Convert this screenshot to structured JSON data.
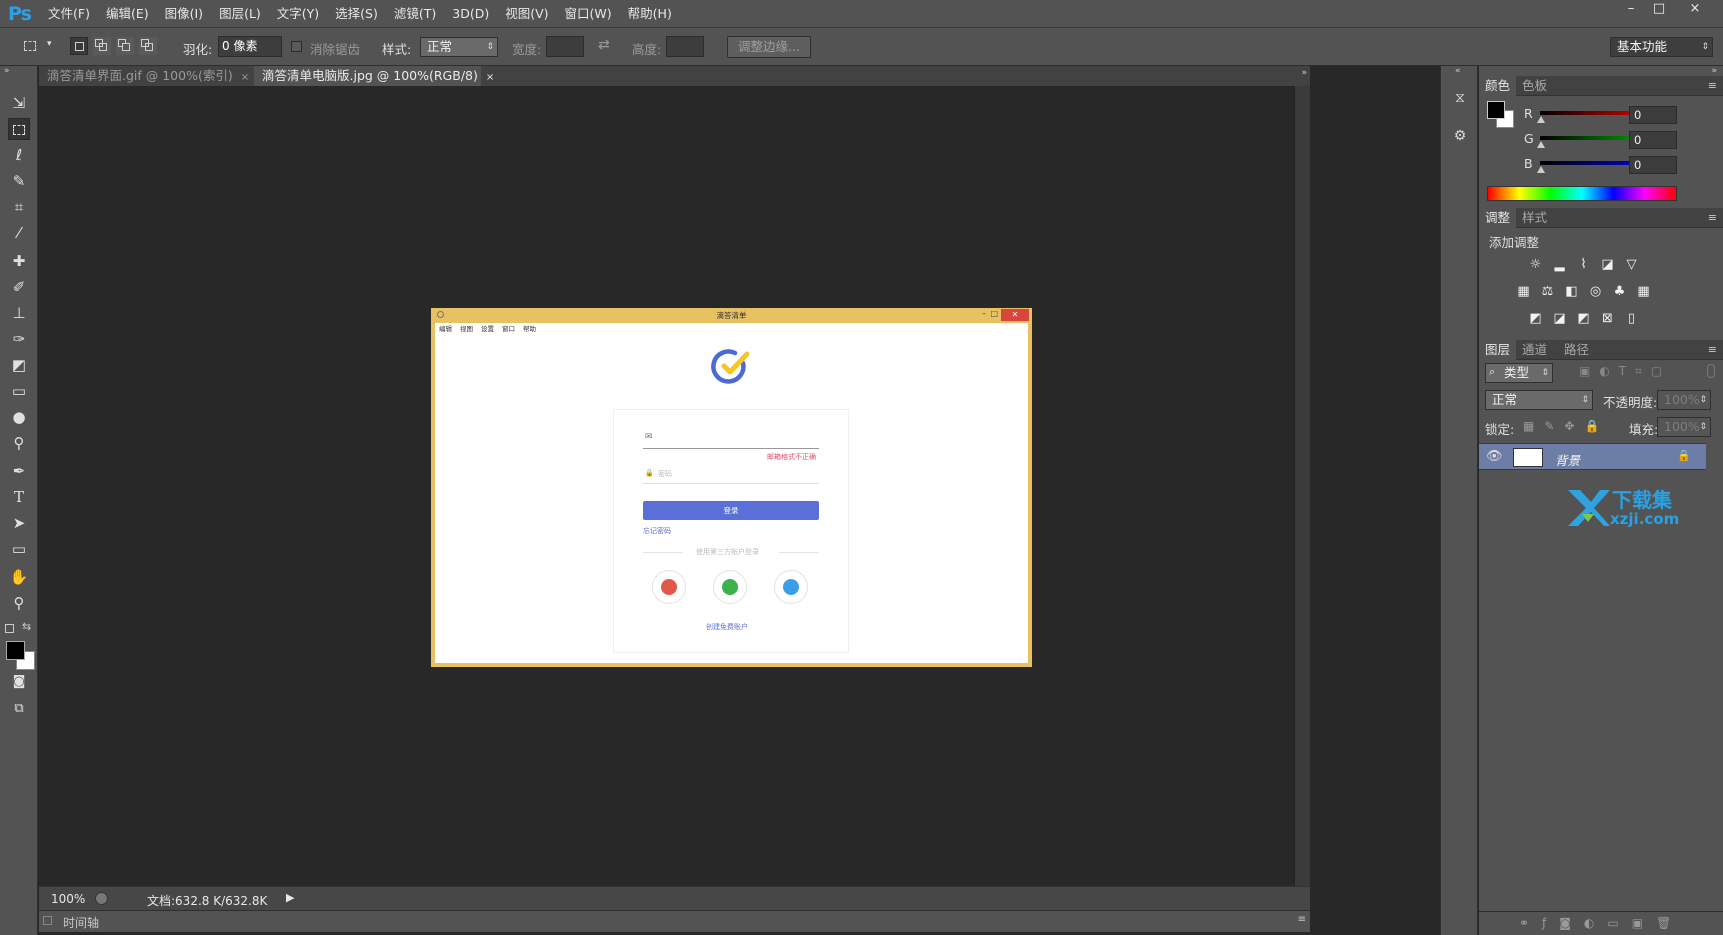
{
  "app": {
    "logo": "Ps",
    "menu": [
      "文件(F)",
      "编辑(E)",
      "图像(I)",
      "图层(L)",
      "文字(Y)",
      "选择(S)",
      "滤镜(T)",
      "3D(D)",
      "视图(V)",
      "窗口(W)",
      "帮助(H)"
    ],
    "window_controls": [
      "–",
      "□",
      "×"
    ]
  },
  "options": {
    "feather_label": "羽化:",
    "feather_value": "0 像素",
    "antialias_label": "消除锯齿",
    "style_label": "样式:",
    "style_value": "正常",
    "width_label": "宽度:",
    "height_label": "高度:",
    "refine_button": "调整边缘...",
    "workspace": "基本功能"
  },
  "tabs": [
    {
      "label": "滴答清单界面.gif @ 100%(索引)",
      "close": "×",
      "active": false
    },
    {
      "label": "滴答清单电脑版.jpg @ 100%(RGB/8)",
      "close": "×",
      "active": true
    }
  ],
  "status": {
    "zoom": "100%",
    "doc_info": "文档:632.8 K/632.8K",
    "timeline": "时间轴"
  },
  "color_panel": {
    "tabs": [
      "颜色",
      "色板"
    ],
    "channels": [
      {
        "name": "R",
        "value": "0",
        "color": "#ff0000"
      },
      {
        "name": "G",
        "value": "0",
        "color": "#00c000"
      },
      {
        "name": "B",
        "value": "0",
        "color": "#0000ff"
      }
    ]
  },
  "adjust_panel": {
    "tabs": [
      "调整",
      "样式"
    ],
    "heading": "添加调整",
    "icons_row1": [
      "brightness-icon",
      "levels-icon",
      "curves-icon",
      "exposure-icon",
      "vibrance-icon"
    ],
    "icons_row2": [
      "hue-saturation-icon",
      "color-balance-icon",
      "black-white-icon",
      "photo-filter-icon",
      "channel-mixer-icon",
      "color-lookup-icon"
    ],
    "icons_row3": [
      "invert-icon",
      "posterize-icon",
      "threshold-icon",
      "selective-color-icon",
      "gradient-map-icon"
    ]
  },
  "layers_panel": {
    "tabs": [
      "图层",
      "通道",
      "路径"
    ],
    "filter_kind": "类型",
    "blend_mode": "正常",
    "opacity_label": "不透明度:",
    "opacity_value": "100%",
    "lock_label": "锁定:",
    "fill_label": "填充:",
    "fill_value": "100%",
    "layers": [
      {
        "name": "背景",
        "visible": true,
        "locked": true
      }
    ]
  },
  "artwork": {
    "window_title": "滴答清单",
    "menu": [
      "编辑",
      "视图",
      "设置",
      "窗口",
      "帮助"
    ],
    "email_error": "邮箱格式不正确",
    "password_placeholder": "密码",
    "login_button": "登录",
    "forgot_password": "忘记密码",
    "third_party": "使用第三方账户登录",
    "create_account": "创建免费账户"
  },
  "watermark": {
    "title": "下载集",
    "domain": "xzji.com"
  },
  "colors": {
    "ps_blue": "#30a0e6",
    "app_frame": "#e8c160",
    "login_blue": "#5b6fd8",
    "error_red": "#e0506a"
  }
}
